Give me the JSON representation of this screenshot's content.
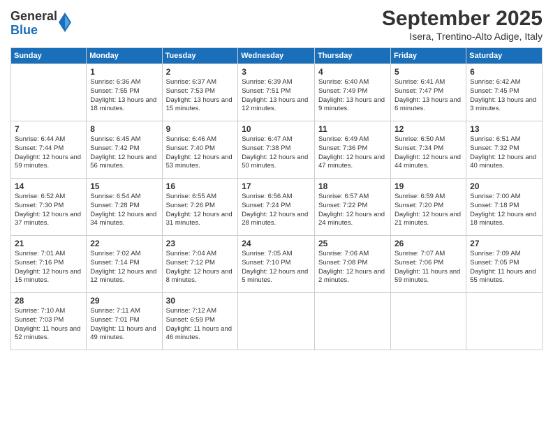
{
  "header": {
    "logo": {
      "general": "General",
      "blue": "Blue"
    },
    "month": "September 2025",
    "location": "Isera, Trentino-Alto Adige, Italy"
  },
  "days_of_week": [
    "Sunday",
    "Monday",
    "Tuesday",
    "Wednesday",
    "Thursday",
    "Friday",
    "Saturday"
  ],
  "weeks": [
    [
      {
        "day": "",
        "sunrise": "",
        "sunset": "",
        "daylight": ""
      },
      {
        "day": "1",
        "sunrise": "Sunrise: 6:36 AM",
        "sunset": "Sunset: 7:55 PM",
        "daylight": "Daylight: 13 hours and 18 minutes."
      },
      {
        "day": "2",
        "sunrise": "Sunrise: 6:37 AM",
        "sunset": "Sunset: 7:53 PM",
        "daylight": "Daylight: 13 hours and 15 minutes."
      },
      {
        "day": "3",
        "sunrise": "Sunrise: 6:39 AM",
        "sunset": "Sunset: 7:51 PM",
        "daylight": "Daylight: 13 hours and 12 minutes."
      },
      {
        "day": "4",
        "sunrise": "Sunrise: 6:40 AM",
        "sunset": "Sunset: 7:49 PM",
        "daylight": "Daylight: 13 hours and 9 minutes."
      },
      {
        "day": "5",
        "sunrise": "Sunrise: 6:41 AM",
        "sunset": "Sunset: 7:47 PM",
        "daylight": "Daylight: 13 hours and 6 minutes."
      },
      {
        "day": "6",
        "sunrise": "Sunrise: 6:42 AM",
        "sunset": "Sunset: 7:45 PM",
        "daylight": "Daylight: 13 hours and 3 minutes."
      }
    ],
    [
      {
        "day": "7",
        "sunrise": "Sunrise: 6:44 AM",
        "sunset": "Sunset: 7:44 PM",
        "daylight": "Daylight: 12 hours and 59 minutes."
      },
      {
        "day": "8",
        "sunrise": "Sunrise: 6:45 AM",
        "sunset": "Sunset: 7:42 PM",
        "daylight": "Daylight: 12 hours and 56 minutes."
      },
      {
        "day": "9",
        "sunrise": "Sunrise: 6:46 AM",
        "sunset": "Sunset: 7:40 PM",
        "daylight": "Daylight: 12 hours and 53 minutes."
      },
      {
        "day": "10",
        "sunrise": "Sunrise: 6:47 AM",
        "sunset": "Sunset: 7:38 PM",
        "daylight": "Daylight: 12 hours and 50 minutes."
      },
      {
        "day": "11",
        "sunrise": "Sunrise: 6:49 AM",
        "sunset": "Sunset: 7:36 PM",
        "daylight": "Daylight: 12 hours and 47 minutes."
      },
      {
        "day": "12",
        "sunrise": "Sunrise: 6:50 AM",
        "sunset": "Sunset: 7:34 PM",
        "daylight": "Daylight: 12 hours and 44 minutes."
      },
      {
        "day": "13",
        "sunrise": "Sunrise: 6:51 AM",
        "sunset": "Sunset: 7:32 PM",
        "daylight": "Daylight: 12 hours and 40 minutes."
      }
    ],
    [
      {
        "day": "14",
        "sunrise": "Sunrise: 6:52 AM",
        "sunset": "Sunset: 7:30 PM",
        "daylight": "Daylight: 12 hours and 37 minutes."
      },
      {
        "day": "15",
        "sunrise": "Sunrise: 6:54 AM",
        "sunset": "Sunset: 7:28 PM",
        "daylight": "Daylight: 12 hours and 34 minutes."
      },
      {
        "day": "16",
        "sunrise": "Sunrise: 6:55 AM",
        "sunset": "Sunset: 7:26 PM",
        "daylight": "Daylight: 12 hours and 31 minutes."
      },
      {
        "day": "17",
        "sunrise": "Sunrise: 6:56 AM",
        "sunset": "Sunset: 7:24 PM",
        "daylight": "Daylight: 12 hours and 28 minutes."
      },
      {
        "day": "18",
        "sunrise": "Sunrise: 6:57 AM",
        "sunset": "Sunset: 7:22 PM",
        "daylight": "Daylight: 12 hours and 24 minutes."
      },
      {
        "day": "19",
        "sunrise": "Sunrise: 6:59 AM",
        "sunset": "Sunset: 7:20 PM",
        "daylight": "Daylight: 12 hours and 21 minutes."
      },
      {
        "day": "20",
        "sunrise": "Sunrise: 7:00 AM",
        "sunset": "Sunset: 7:18 PM",
        "daylight": "Daylight: 12 hours and 18 minutes."
      }
    ],
    [
      {
        "day": "21",
        "sunrise": "Sunrise: 7:01 AM",
        "sunset": "Sunset: 7:16 PM",
        "daylight": "Daylight: 12 hours and 15 minutes."
      },
      {
        "day": "22",
        "sunrise": "Sunrise: 7:02 AM",
        "sunset": "Sunset: 7:14 PM",
        "daylight": "Daylight: 12 hours and 12 minutes."
      },
      {
        "day": "23",
        "sunrise": "Sunrise: 7:04 AM",
        "sunset": "Sunset: 7:12 PM",
        "daylight": "Daylight: 12 hours and 8 minutes."
      },
      {
        "day": "24",
        "sunrise": "Sunrise: 7:05 AM",
        "sunset": "Sunset: 7:10 PM",
        "daylight": "Daylight: 12 hours and 5 minutes."
      },
      {
        "day": "25",
        "sunrise": "Sunrise: 7:06 AM",
        "sunset": "Sunset: 7:08 PM",
        "daylight": "Daylight: 12 hours and 2 minutes."
      },
      {
        "day": "26",
        "sunrise": "Sunrise: 7:07 AM",
        "sunset": "Sunset: 7:06 PM",
        "daylight": "Daylight: 11 hours and 59 minutes."
      },
      {
        "day": "27",
        "sunrise": "Sunrise: 7:09 AM",
        "sunset": "Sunset: 7:05 PM",
        "daylight": "Daylight: 11 hours and 55 minutes."
      }
    ],
    [
      {
        "day": "28",
        "sunrise": "Sunrise: 7:10 AM",
        "sunset": "Sunset: 7:03 PM",
        "daylight": "Daylight: 11 hours and 52 minutes."
      },
      {
        "day": "29",
        "sunrise": "Sunrise: 7:11 AM",
        "sunset": "Sunset: 7:01 PM",
        "daylight": "Daylight: 11 hours and 49 minutes."
      },
      {
        "day": "30",
        "sunrise": "Sunrise: 7:12 AM",
        "sunset": "Sunset: 6:59 PM",
        "daylight": "Daylight: 11 hours and 46 minutes."
      },
      {
        "day": "",
        "sunrise": "",
        "sunset": "",
        "daylight": ""
      },
      {
        "day": "",
        "sunrise": "",
        "sunset": "",
        "daylight": ""
      },
      {
        "day": "",
        "sunrise": "",
        "sunset": "",
        "daylight": ""
      },
      {
        "day": "",
        "sunrise": "",
        "sunset": "",
        "daylight": ""
      }
    ]
  ]
}
